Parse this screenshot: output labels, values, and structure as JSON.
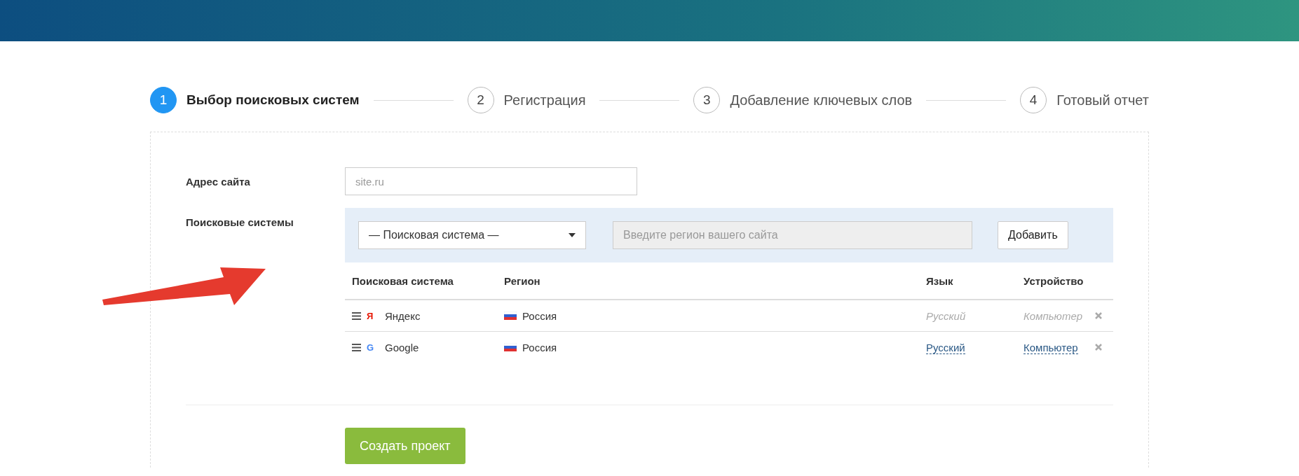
{
  "steps": [
    {
      "number": "1",
      "label": "Выбор поисковых систем",
      "selected": true
    },
    {
      "number": "2",
      "label": "Регистрация",
      "selected": false
    },
    {
      "number": "3",
      "label": "Добавление ключевых слов",
      "selected": false
    },
    {
      "number": "4",
      "label": "Готовый отчет",
      "selected": false
    }
  ],
  "site": {
    "label": "Адрес сайта",
    "placeholder": "site.ru"
  },
  "engines": {
    "label": "Поисковые системы",
    "select": "— Поисковая система —",
    "region_placeholder": "Введите регион вашего сайта",
    "add_button": "Добавить",
    "columns": [
      "Поисковая система",
      "Регион",
      "Язык",
      "Устройство"
    ],
    "rows": [
      {
        "logo": "Я",
        "color": "#e61400",
        "name": "Яндекс",
        "region": "Россия",
        "language": "Русский",
        "device": "Компьютер",
        "disabled": true
      },
      {
        "logo": "G",
        "color": "#4285f4",
        "name": "Google",
        "region": "Россия",
        "language": "Русский",
        "device": "Компьютер",
        "disabled": false
      }
    ]
  },
  "create_button": "Создать проект"
}
